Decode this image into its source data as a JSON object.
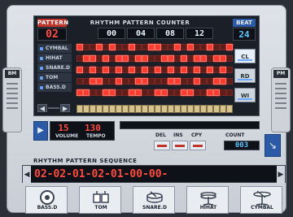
{
  "pattern": {
    "label": "PATTERN",
    "value": "02"
  },
  "rhythm_counter": {
    "label": "RHYTHM PATTERN COUNTER",
    "values": [
      "00",
      "04",
      "08",
      "12"
    ]
  },
  "beat": {
    "label": "BEAT",
    "value": "24"
  },
  "tracks": [
    "CYMBAL",
    "HIHAT",
    "SNARE.D",
    "TOM",
    "BASS.D"
  ],
  "grid": {
    "rows": [
      [
        1,
        0,
        0,
        1,
        0,
        1,
        0,
        0,
        1,
        0,
        0,
        1,
        1,
        0,
        0,
        1,
        0,
        1,
        0,
        0,
        1,
        0,
        0,
        1
      ],
      [
        0,
        1,
        1,
        0,
        1,
        0,
        1,
        1,
        0,
        1,
        1,
        0,
        0,
        1,
        1,
        0,
        1,
        0,
        1,
        1,
        0,
        1,
        1,
        0
      ],
      [
        1,
        0,
        1,
        0,
        1,
        0,
        1,
        0,
        1,
        0,
        1,
        0,
        1,
        0,
        1,
        0,
        1,
        0,
        1,
        0,
        1,
        0,
        1,
        0
      ],
      [
        0,
        0,
        1,
        1,
        0,
        0,
        1,
        0,
        0,
        1,
        1,
        0,
        0,
        0,
        1,
        1,
        0,
        0,
        1,
        0,
        0,
        1,
        1,
        0
      ],
      [
        1,
        1,
        0,
        0,
        1,
        1,
        0,
        0,
        1,
        1,
        0,
        0,
        1,
        1,
        0,
        0,
        1,
        1,
        0,
        0,
        1,
        1,
        0,
        0
      ]
    ]
  },
  "side_buttons": [
    "CL",
    "RD",
    "WI"
  ],
  "left_side_label": "BM",
  "right_side_label": "PM",
  "nav": {
    "left": "◀",
    "right": "▶"
  },
  "volume": {
    "label": "VOLUME",
    "value": "15"
  },
  "tempo": {
    "label": "TEMPO",
    "value": "130"
  },
  "edit": {
    "del_label": "DEL",
    "ins_label": "INS",
    "cpy_label": "CPY",
    "count_label": "COUNT",
    "count_value": "003"
  },
  "sequence": {
    "label": "RHYTHM PATTERN SEQUENCE",
    "text": "02-02-01-02-01-00-00-"
  },
  "instruments": [
    "BASS.D",
    "TOM",
    "SNARE.D",
    "HIHAT",
    "CYMBAL"
  ]
}
